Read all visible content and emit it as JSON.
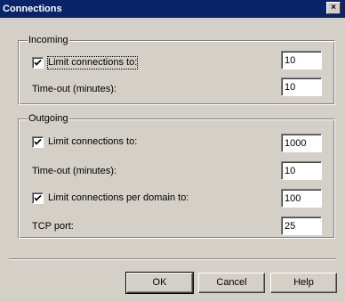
{
  "window": {
    "title": "Connections",
    "close_glyph": "×"
  },
  "incoming": {
    "group_label": "Incoming",
    "limit_connections": {
      "label": "Limit connections to:",
      "checked": true,
      "value": "10"
    },
    "timeout": {
      "label": "Time-out (minutes):",
      "value": "10"
    }
  },
  "outgoing": {
    "group_label": "Outgoing",
    "limit_connections": {
      "label": "Limit connections to:",
      "checked": true,
      "value": "1000"
    },
    "timeout": {
      "label": "Time-out (minutes):",
      "value": "10"
    },
    "limit_per_domain": {
      "label": "Limit connections per domain to:",
      "checked": true,
      "value": "100"
    },
    "tcp_port": {
      "label": "TCP port:",
      "value": "25"
    }
  },
  "buttons": {
    "ok": "OK",
    "cancel": "Cancel",
    "help": "Help"
  }
}
